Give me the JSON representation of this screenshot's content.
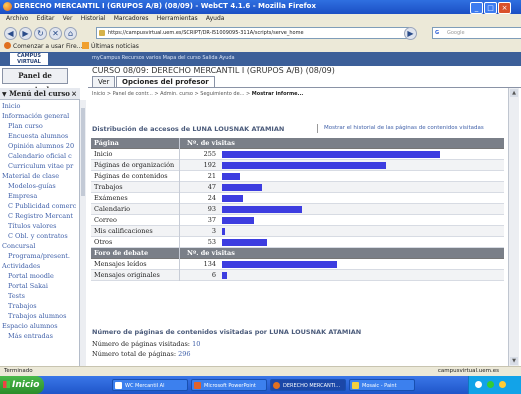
{
  "window": {
    "title": "DERECHO MERCANTIL I (GRUPOS A/B) (08/09) - WebCT 4.1.6 - Mozilla Firefox"
  },
  "menubar": {
    "items": [
      "Archivo",
      "Editar",
      "Ver",
      "Historial",
      "Marcadores",
      "Herramientas",
      "Ayuda"
    ]
  },
  "navbar": {
    "url": "https://campusvirtual.uem.es/SCRIPT/DR-I51009095-311A/scripts/serve_home",
    "search_placeholder": "Google"
  },
  "bookmarks": {
    "items": [
      "Comenzar a usar Fire...",
      "Últimas noticias"
    ]
  },
  "banner": {
    "logo_line1": "CAMPUS",
    "logo_line2": "VIRTUAL",
    "links": "myCampus   Recursos varios   Mapa del curso   Salida   Ayuda"
  },
  "panel_button": "Panel de control",
  "course_title": "CURSO 08/09: DERECHO MERCANTIL I (GRUPOS A/B) (08/09)",
  "tabs": [
    {
      "label": "Ver"
    },
    {
      "label": "Opciones del profesor"
    }
  ],
  "sidebar": {
    "header": "Menú del curso",
    "items": [
      "Inicio",
      "Información general",
      "Plan curso",
      "Encuesta alumnos",
      "Opinión alumnos 20",
      "Calendario oficial c",
      "Curriculum vitae pr",
      "Material de clase",
      "Modelos-guías",
      "Empresa",
      "C Publicidad comerc",
      "C Registro Mercant",
      "Títulos valores",
      "C Obl. y contratos",
      "Concursal",
      "Programa/present.",
      "Actividades",
      "Portal moodle",
      "Portal Sakai",
      "Tests",
      "Trabajos",
      "Trabajos alumnos",
      "Espacio alumnos",
      "Más entradas"
    ]
  },
  "breadcrumb": {
    "path": "Inicio > Panel de contr... > Admin. curso > Seguimiento de... > ",
    "current": "Mostrar informe..."
  },
  "distribution": {
    "title": "Distribución de accesos de LUNA LOUSNAK ATAMIAN",
    "history_link": "Mostrar el historial de las páginas de contenidos visitadas",
    "col_page": "Página",
    "col_visits": "Nº. de visitas",
    "forum_header": "Foro de debate",
    "forum_col_visits": "Nº. de visitas",
    "max_visits": 255
  },
  "chart_data": {
    "type": "bar",
    "title": "Distribución de accesos de LUNA LOUSNAK ATAMIAN",
    "xlabel": "",
    "ylabel": "Nº. de visitas",
    "categories": [
      "Inicio",
      "Páginas de organización",
      "Páginas de contenidos",
      "Trabajos",
      "Exámenes",
      "Calendario",
      "Correo",
      "Mis calificaciones",
      "Otros"
    ],
    "values": [
      255,
      192,
      21,
      47,
      24,
      93,
      37,
      3,
      53
    ],
    "forum": {
      "categories": [
        "Mensajes leídos",
        "Mensajes originales"
      ],
      "values": [
        134,
        6
      ]
    }
  },
  "content_visits": {
    "title": "Número de páginas de contenidos visitadas por LUNA LOUSNAK ATAMIAN",
    "visited_label": "Número de páginas visitadas:",
    "visited_value": "10",
    "total_label": "Número total de páginas:",
    "total_value": "296"
  },
  "status": {
    "left": "Terminado",
    "right": "campusvirtual.uem.es"
  },
  "taskbar": {
    "start": "Inicio",
    "items": [
      "WC Mercantil Al",
      "Microsoft PowerPoint",
      "DERECHO MERCANTI...",
      "Mosaic - Paint"
    ]
  },
  "colors": {
    "bar": "#3d3de0",
    "banner": "#3c5f99",
    "table_header": "#7a7f88"
  }
}
